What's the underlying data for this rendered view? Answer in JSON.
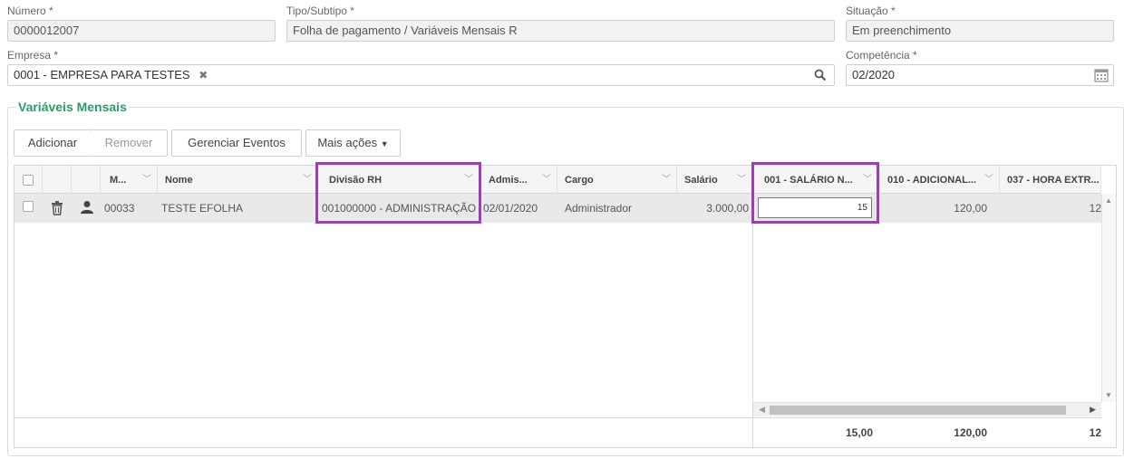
{
  "form": {
    "numero_label": "Número *",
    "numero_value": "0000012007",
    "tipo_label": "Tipo/Subtipo *",
    "tipo_value": "Folha de pagamento / Variáveis Mensais R",
    "situacao_label": "Situação *",
    "situacao_value": "Em preenchimento",
    "empresa_label": "Empresa *",
    "empresa_value": "0001 - EMPRESA PARA TESTES",
    "competencia_label": "Competência *",
    "competencia_value": "02/2020"
  },
  "section": {
    "title": "Variáveis Mensais"
  },
  "toolbar": {
    "add_label": "Adicionar",
    "remove_label": "Remover",
    "manage_label": "Gerenciar Eventos",
    "more_label": "Mais ações"
  },
  "grid": {
    "left_headers": {
      "matricula": "M...",
      "nome": "Nome",
      "divisao": "Divisão RH",
      "admissao": "Admis...",
      "cargo": "Cargo",
      "salario": "Salário"
    },
    "right_headers": {
      "ev001": "001 - SALÁRIO N...",
      "ev010": "010 - ADICIONAL...",
      "ev037": "037 - HORA EXTR..."
    },
    "row": {
      "matricula": "00033",
      "nome": "TESTE EFOLHA",
      "divisao": "001000000 - ADMINISTRAÇÃO",
      "admissao": "02/01/2020",
      "cargo": "Administrador",
      "salario": "3.000,00",
      "ev001_input": "15",
      "ev010": "120,00",
      "ev037": "12"
    },
    "totals": {
      "ev001": "15,00",
      "ev010": "120,00",
      "ev037": "12"
    }
  },
  "colors": {
    "accent_green": "#2a9d66",
    "highlight_purple": "#9c3fb0"
  }
}
